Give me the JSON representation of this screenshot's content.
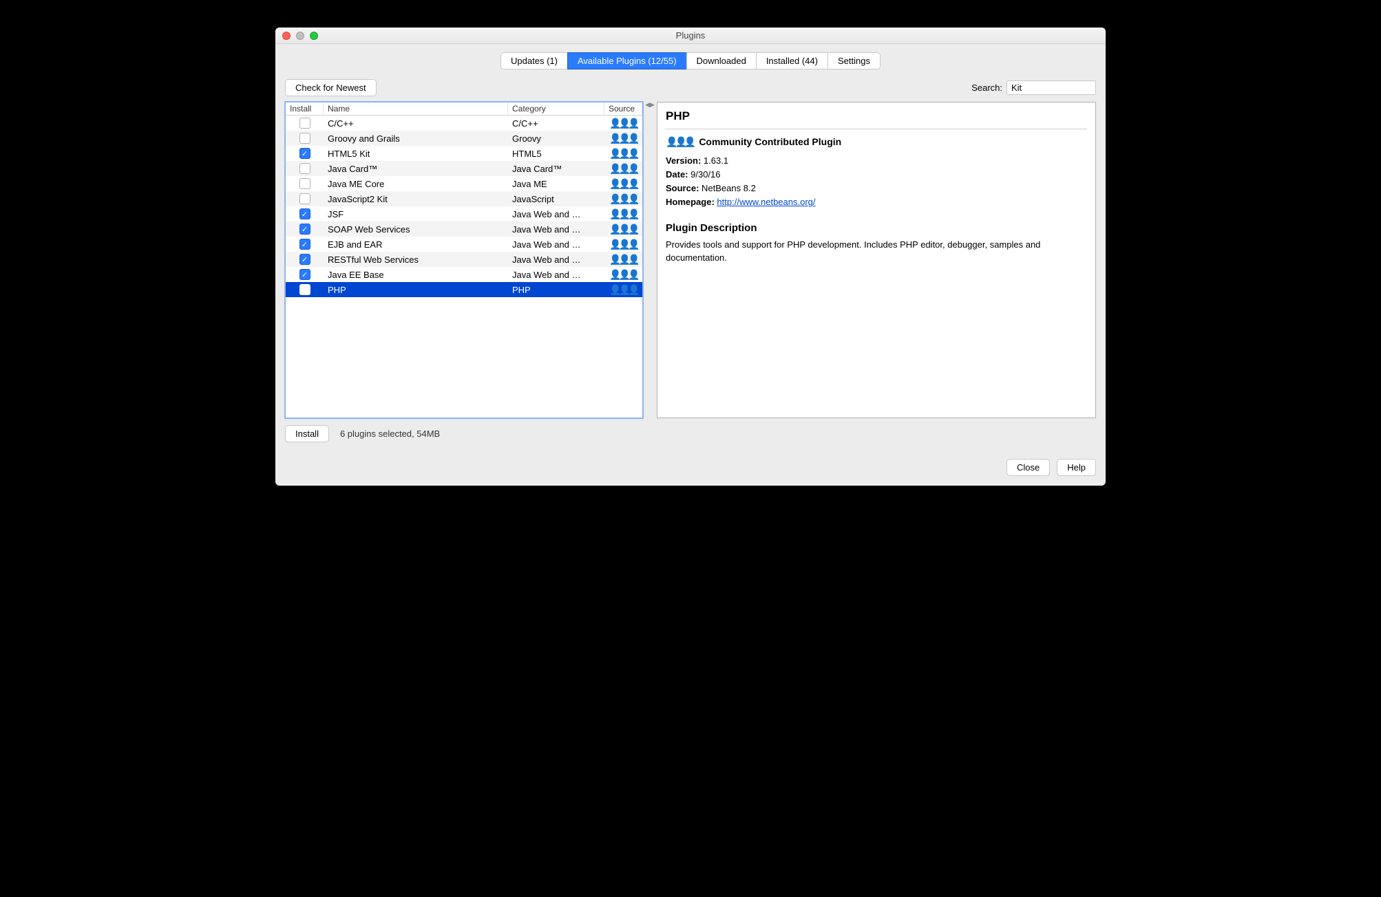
{
  "window": {
    "title": "Plugins"
  },
  "tabs": [
    {
      "label": "Updates (1)"
    },
    {
      "label": "Available Plugins (12/55)"
    },
    {
      "label": "Downloaded"
    },
    {
      "label": "Installed (44)"
    },
    {
      "label": "Settings"
    }
  ],
  "active_tab_index": 1,
  "toolbar": {
    "check_newest": "Check for Newest",
    "search_label": "Search:",
    "search_value": "Kit"
  },
  "columns": {
    "install": "Install",
    "name": "Name",
    "category": "Category",
    "source": "Source"
  },
  "plugins": [
    {
      "checked": false,
      "name": "C/C++",
      "category": "C/C++"
    },
    {
      "checked": false,
      "name": "Groovy and Grails",
      "category": "Groovy"
    },
    {
      "checked": true,
      "name": "HTML5 Kit",
      "category": "HTML5"
    },
    {
      "checked": false,
      "name": "Java Card™",
      "category": "Java Card™"
    },
    {
      "checked": false,
      "name": "Java ME Core",
      "category": "Java ME"
    },
    {
      "checked": false,
      "name": "JavaScript2 Kit",
      "category": "JavaScript"
    },
    {
      "checked": true,
      "name": "JSF",
      "category": "Java Web and …"
    },
    {
      "checked": true,
      "name": "SOAP Web Services",
      "category": "Java Web and …"
    },
    {
      "checked": true,
      "name": "EJB and EAR",
      "category": "Java Web and …"
    },
    {
      "checked": true,
      "name": "RESTful Web Services",
      "category": "Java Web and …"
    },
    {
      "checked": true,
      "name": "Java EE Base",
      "category": "Java Web and …"
    },
    {
      "checked": false,
      "name": "PHP",
      "category": "PHP",
      "selected": true
    }
  ],
  "detail": {
    "title": "PHP",
    "community_label": "Community Contributed Plugin",
    "version_label": "Version:",
    "version": "1.63.1",
    "date_label": "Date:",
    "date": "9/30/16",
    "source_label": "Source:",
    "source": "NetBeans 8.2",
    "homepage_label": "Homepage:",
    "homepage": "http://www.netbeans.org/",
    "desc_heading": "Plugin Description",
    "description": "Provides tools and support for PHP development. Includes PHP editor, debugger, samples and documentation."
  },
  "bottom": {
    "install_button": "Install",
    "status": "6 plugins selected, 54MB"
  },
  "footer": {
    "close": "Close",
    "help": "Help"
  }
}
